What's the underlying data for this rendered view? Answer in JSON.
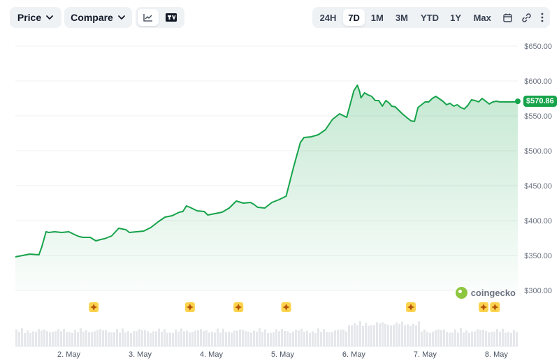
{
  "toolbar": {
    "price_label": "Price",
    "compare_label": "Compare",
    "ranges": [
      "24H",
      "7D",
      "1M",
      "3M",
      "YTD",
      "1Y",
      "Max"
    ],
    "active_range": "7D",
    "icons": [
      "line-chart-icon",
      "tradingview-icon",
      "calendar-icon",
      "link-icon",
      "more-vertical-icon"
    ]
  },
  "chart_data": {
    "type": "area",
    "y_ticks": [
      "$650.00",
      "$600.00",
      "$550.00",
      "$500.00",
      "$450.00",
      "$400.00",
      "$350.00",
      "$300.00"
    ],
    "y_tick_values": [
      650,
      600,
      550,
      500,
      450,
      400,
      350,
      300
    ],
    "ylim": [
      300,
      650
    ],
    "x_ticks": [
      "2. May",
      "3. May",
      "4. May",
      "5. May",
      "6. May",
      "7. May",
      "8. May"
    ],
    "x_tick_values": [
      1.0,
      2.0,
      3.0,
      4.0,
      5.0,
      6.0,
      7.0
    ],
    "xlim": [
      0.25,
      7.3
    ],
    "grid": true,
    "current_price": "$570.86",
    "current_value": 570.86,
    "color": "#16a34a",
    "x": [
      0.25,
      0.35,
      0.45,
      0.58,
      0.62,
      0.68,
      0.72,
      0.8,
      0.9,
      1.0,
      1.1,
      1.15,
      1.2,
      1.3,
      1.38,
      1.45,
      1.5,
      1.6,
      1.7,
      1.8,
      1.85,
      1.95,
      2.05,
      2.15,
      2.25,
      2.35,
      2.45,
      2.55,
      2.6,
      2.65,
      2.7,
      2.8,
      2.9,
      2.95,
      3.05,
      3.15,
      3.25,
      3.35,
      3.45,
      3.55,
      3.6,
      3.65,
      3.75,
      3.8,
      3.85,
      3.95,
      4.05,
      4.15,
      4.25,
      4.3,
      4.4,
      4.5,
      4.6,
      4.7,
      4.8,
      4.9,
      5.0,
      5.05,
      5.08,
      5.1,
      5.15,
      5.2,
      5.25,
      5.3,
      5.35,
      5.4,
      5.45,
      5.5,
      5.53,
      5.58,
      5.63,
      5.68,
      5.75,
      5.8,
      5.85,
      5.9,
      5.95,
      6.0,
      6.05,
      6.1,
      6.15,
      6.25,
      6.3,
      6.35,
      6.4,
      6.45,
      6.5,
      6.55,
      6.6,
      6.65,
      6.7,
      6.75,
      6.8,
      6.85,
      6.9,
      6.95,
      7.0,
      7.05,
      7.1,
      7.15,
      7.2,
      7.25,
      7.3
    ],
    "values": [
      348,
      350,
      352,
      351,
      362,
      384,
      383,
      384,
      383,
      384,
      379,
      377,
      376,
      376,
      371,
      373,
      374,
      378,
      389,
      387,
      383,
      384,
      385,
      390,
      398,
      405,
      407,
      412,
      413,
      421,
      419,
      414,
      413,
      408,
      410,
      412,
      418,
      428,
      425,
      426,
      423,
      419,
      418,
      422,
      426,
      430,
      435,
      475,
      512,
      519,
      520,
      523,
      530,
      545,
      553,
      548,
      586,
      594,
      585,
      576,
      583,
      580,
      578,
      572,
      572,
      564,
      572,
      568,
      564,
      563,
      558,
      553,
      547,
      543,
      542,
      562,
      566,
      570,
      570,
      575,
      578,
      571,
      566,
      568,
      564,
      566,
      562,
      560,
      565,
      573,
      572,
      570,
      575,
      571,
      567,
      570,
      571,
      570,
      570,
      570,
      570,
      570,
      570.86
    ]
  },
  "events": {
    "x": [
      1.35,
      2.7,
      3.38,
      4.05,
      5.8,
      6.82,
      6.98
    ]
  },
  "watermark": "coingecko"
}
